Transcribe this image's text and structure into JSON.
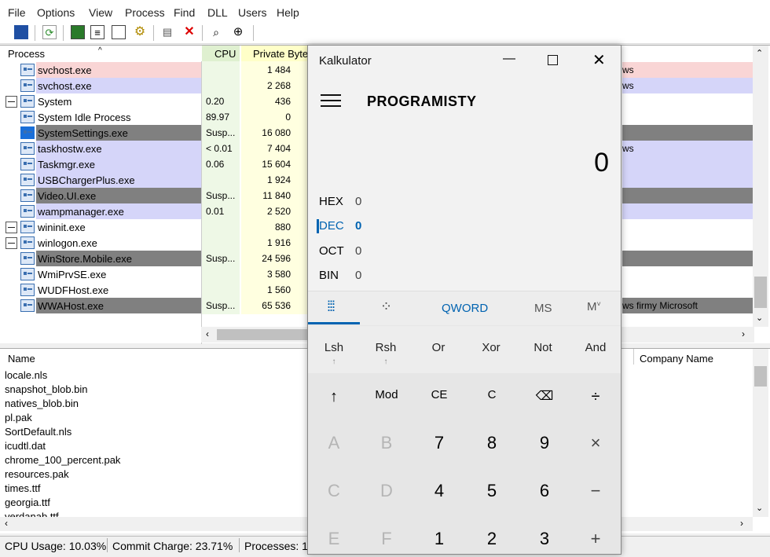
{
  "menu": [
    "File",
    "Options",
    "View",
    "Process",
    "Find",
    "DLL",
    "Users",
    "Help"
  ],
  "columns": {
    "process": "Process",
    "cpu": "CPU",
    "private_bytes": "Private Byte"
  },
  "processes": [
    {
      "name": "svchost.exe",
      "cpu": "",
      "pb": "1 484",
      "company": "ws",
      "bg": "#f9d5d5"
    },
    {
      "name": "svchost.exe",
      "cpu": "",
      "pb": "2 268",
      "company": "ws",
      "bg": "#d5d5f9"
    },
    {
      "name": "System",
      "cpu": "0.20",
      "pb": "436",
      "company": "",
      "bg": "#ffffff"
    },
    {
      "name": "System Idle Process",
      "cpu": "89.97",
      "pb": "0",
      "company": "",
      "bg": "#ffffff"
    },
    {
      "name": "SystemSettings.exe",
      "cpu": "Susp...",
      "pb": "16 080",
      "company": "",
      "bg": "#808080"
    },
    {
      "name": "taskhostw.exe",
      "cpu": "< 0.01",
      "pb": "7 404",
      "company": "ws",
      "bg": "#d5d5f9"
    },
    {
      "name": "Taskmgr.exe",
      "cpu": "0.06",
      "pb": "15 604",
      "company": "",
      "bg": "#d5d5f9"
    },
    {
      "name": "USBChargerPlus.exe",
      "cpu": "",
      "pb": "1 924",
      "company": "",
      "bg": "#d5d5f9"
    },
    {
      "name": "Video.UI.exe",
      "cpu": "Susp...",
      "pb": "11 840",
      "company": "",
      "bg": "#808080"
    },
    {
      "name": "wampmanager.exe",
      "cpu": "0.01",
      "pb": "2 520",
      "company": "",
      "bg": "#d5d5f9"
    },
    {
      "name": "wininit.exe",
      "cpu": "",
      "pb": "880",
      "company": "",
      "bg": "#ffffff"
    },
    {
      "name": "winlogon.exe",
      "cpu": "",
      "pb": "1 916",
      "company": "",
      "bg": "#ffffff"
    },
    {
      "name": "WinStore.Mobile.exe",
      "cpu": "Susp...",
      "pb": "24 596",
      "company": "",
      "bg": "#808080"
    },
    {
      "name": "WmiPrvSE.exe",
      "cpu": "",
      "pb": "3 580",
      "company": "",
      "bg": "#ffffff"
    },
    {
      "name": "WUDFHost.exe",
      "cpu": "",
      "pb": "1 560",
      "company": "",
      "bg": "#ffffff"
    },
    {
      "name": "WWAHost.exe",
      "cpu": "Susp...",
      "pb": "65 536",
      "company": "ws firmy Microsoft",
      "bg": "#808080"
    }
  ],
  "lower": {
    "name_header": "Name",
    "company_header": "Company Name",
    "files": [
      "locale.nls",
      "snapshot_blob.bin",
      "natives_blob.bin",
      "pl.pak",
      "SortDefault.nls",
      "icudtl.dat",
      "chrome_100_percent.pak",
      "resources.pak",
      "times.ttf",
      "georgia.ttf",
      "verdanab.ttf"
    ]
  },
  "status": {
    "cpu": "CPU Usage: 10.03%",
    "commit": "Commit Charge: 23.71%",
    "processes": "Processes: 1"
  },
  "calc": {
    "title": "Kalkulator",
    "mode": "PROGRAMISTY",
    "display": "0",
    "bases": [
      {
        "label": "HEX",
        "value": "0"
      },
      {
        "label": "DEC",
        "value": "0"
      },
      {
        "label": "OCT",
        "value": "0"
      },
      {
        "label": "BIN",
        "value": "0"
      }
    ],
    "word_size": "QWORD",
    "ms": "MS",
    "mplus": "M",
    "bitwise": [
      "Lsh",
      "Rsh",
      "Or",
      "Xor",
      "Not",
      "And"
    ],
    "keys": [
      [
        "↑",
        "Mod",
        "CE",
        "C",
        "⌫",
        "÷"
      ],
      [
        "A",
        "B",
        "7",
        "8",
        "9",
        "×"
      ],
      [
        "C",
        "D",
        "4",
        "5",
        "6",
        "−"
      ],
      [
        "E",
        "F",
        "1",
        "2",
        "3",
        "+"
      ]
    ],
    "accent": "#0063b1"
  }
}
